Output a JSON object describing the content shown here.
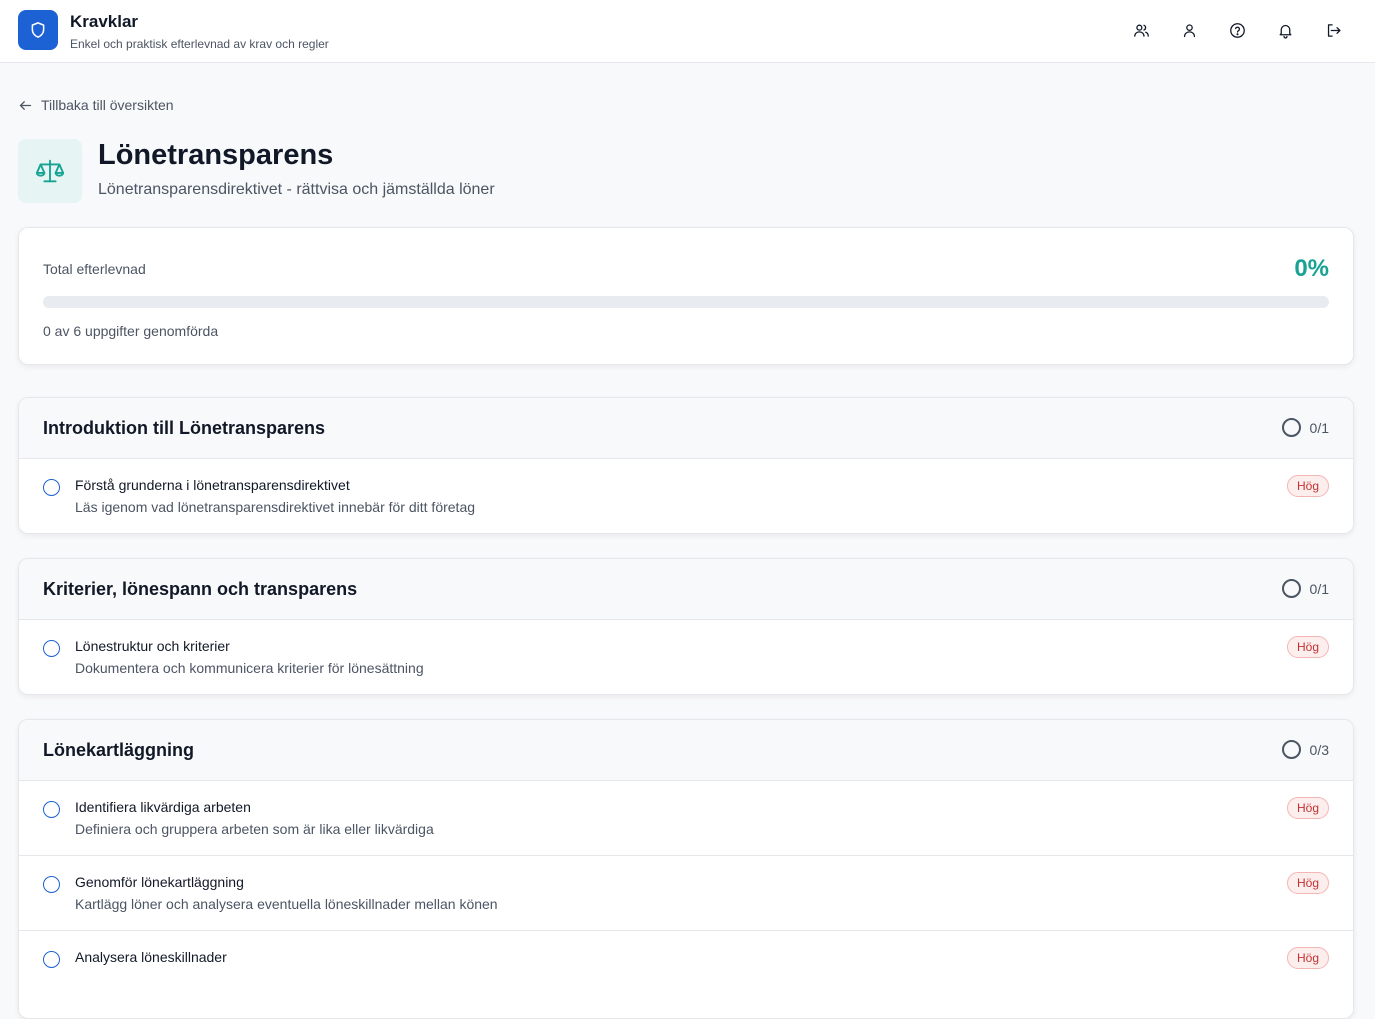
{
  "header": {
    "app_name": "Kravklar",
    "tagline": "Enkel och praktisk efterlevnad av krav och regler",
    "logo_icon": "shield-icon",
    "brand_color": "#1d62d4",
    "nav_icons": [
      "users-icon",
      "user-icon",
      "help-icon",
      "bell-icon",
      "logout-icon"
    ]
  },
  "back_link": "Tillbaka till översikten",
  "page": {
    "title": "Lönetransparens",
    "subtitle": "Lönetransparensdirektivet - rättvisa och jämställda löner",
    "icon": "scale-icon",
    "accent_color": "#16a394"
  },
  "progress": {
    "label": "Total efterlevnad",
    "percent_text": "0%",
    "fraction": 0,
    "count_text": "0 av 6 uppgifter genomförda"
  },
  "sections": [
    {
      "title": "Introduktion till Lönetransparens",
      "status": "0/1",
      "tasks": [
        {
          "title": "Förstå grunderna i lönetransparensdirektivet",
          "desc": "Läs igenom vad lönetransparensdirektivet innebär för ditt företag",
          "priority": "Hög"
        }
      ]
    },
    {
      "title": "Kriterier, lönespann och transparens",
      "status": "0/1",
      "tasks": [
        {
          "title": "Lönestruktur och kriterier",
          "desc": "Dokumentera och kommunicera kriterier för lönesättning",
          "priority": "Hög"
        }
      ]
    },
    {
      "title": "Lönekartläggning",
      "status": "0/3",
      "tasks": [
        {
          "title": "Identifiera likvärdiga arbeten",
          "desc": "Definiera och gruppera arbeten som är lika eller likvärdiga",
          "priority": "Hög"
        },
        {
          "title": "Genomför lönekartläggning",
          "desc": "Kartlägg löner och analysera eventuella löneskillnader mellan könen",
          "priority": "Hög"
        },
        {
          "title": "Analysera löneskillnader",
          "desc": "",
          "priority": "Hög"
        }
      ]
    }
  ]
}
